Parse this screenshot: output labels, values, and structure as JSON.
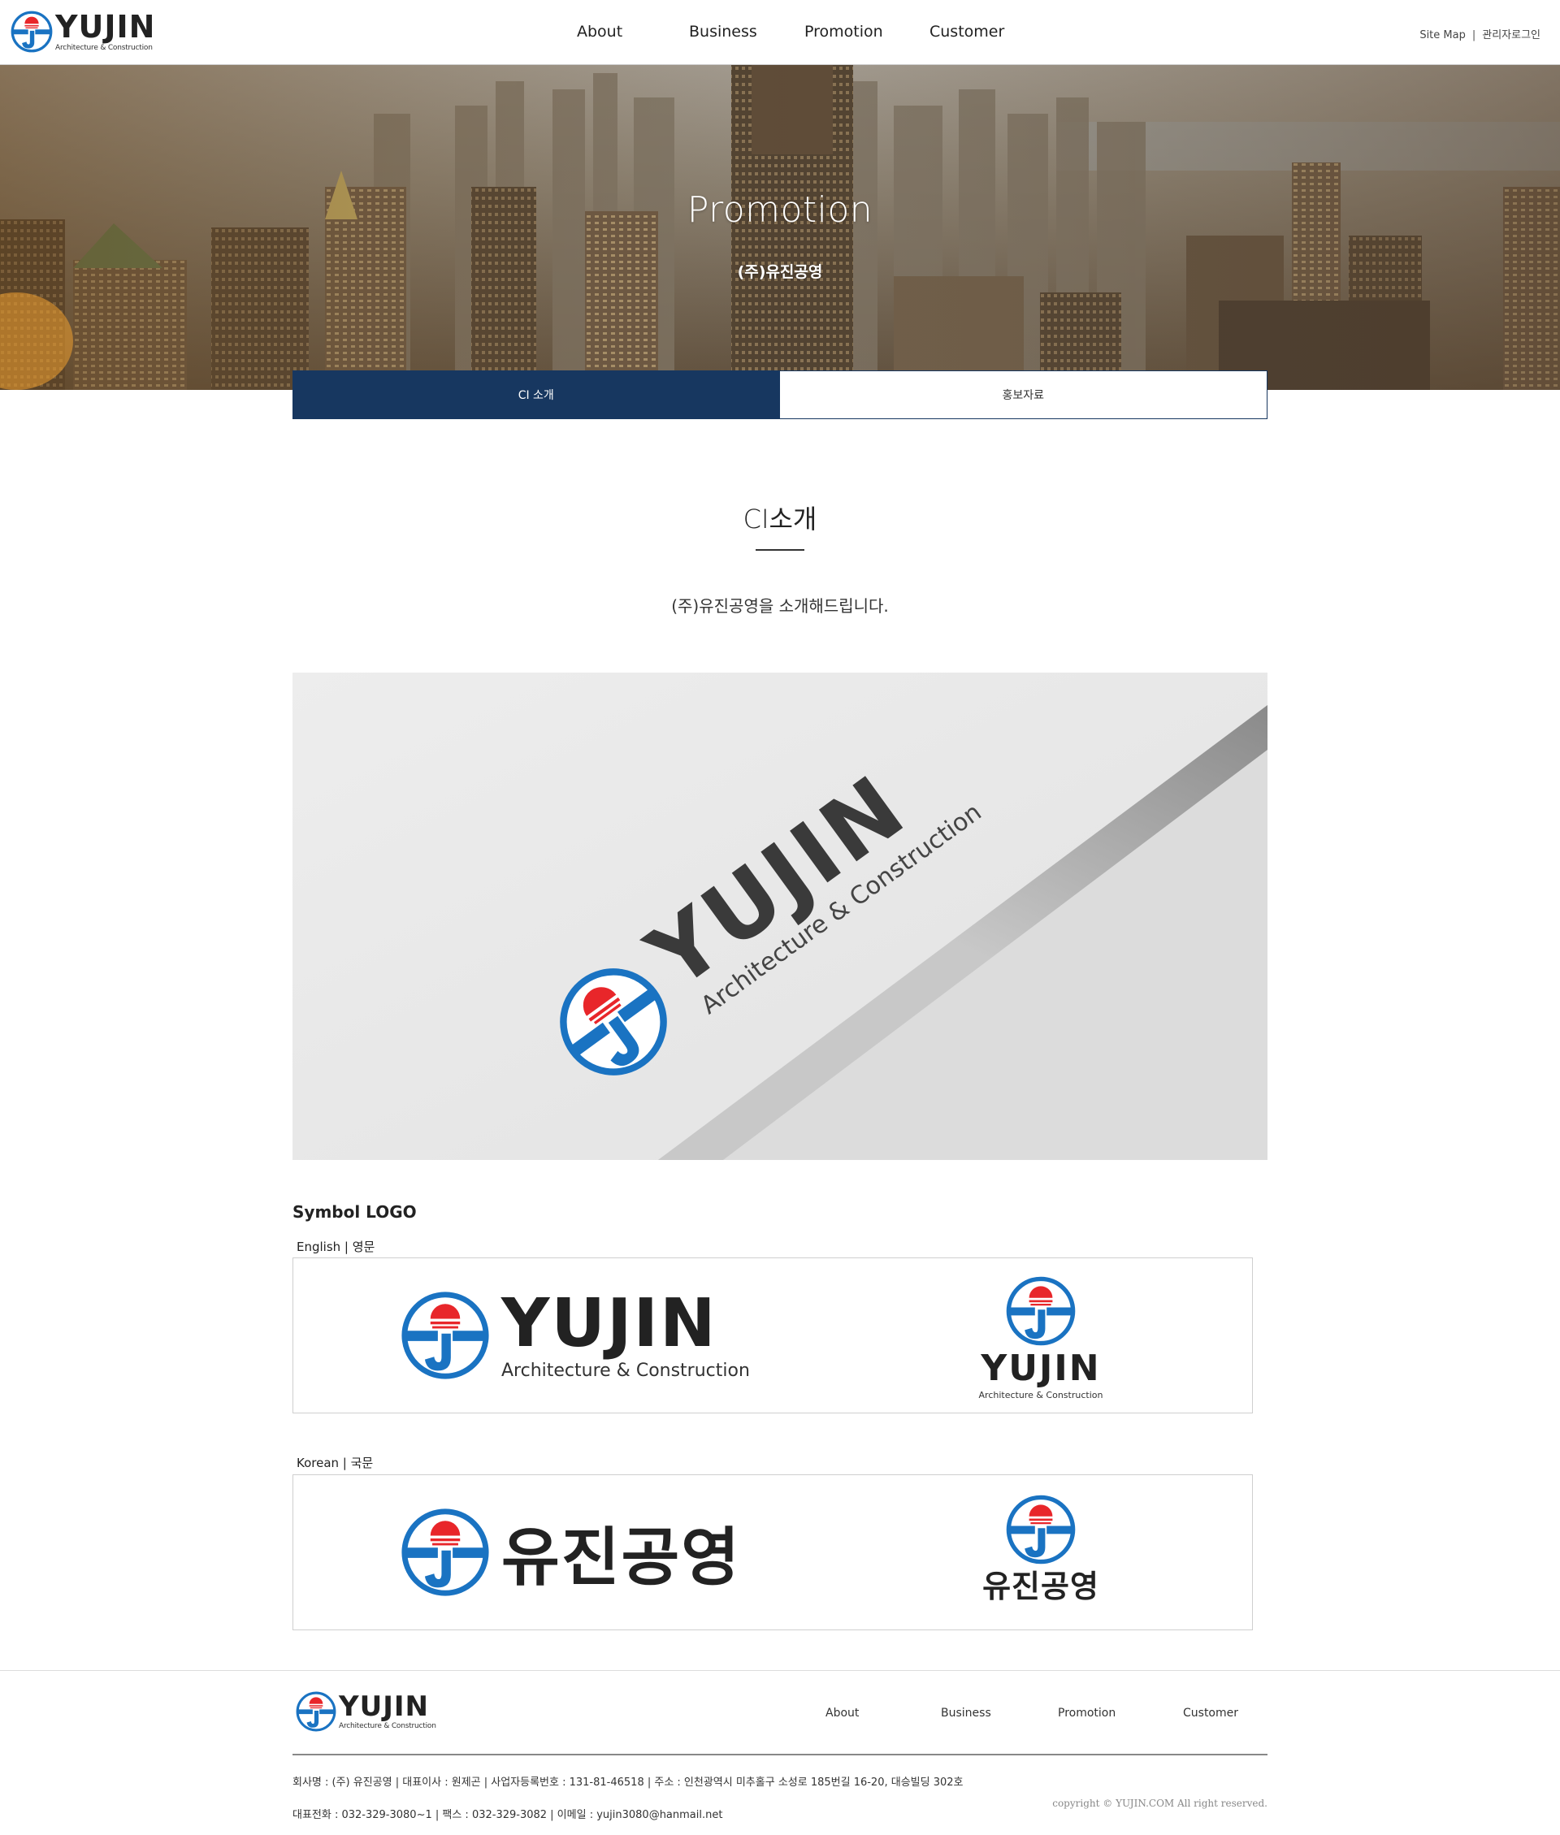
{
  "header": {
    "brand_name": "YUJIN",
    "brand_sub": "Architecture & Construction",
    "nav": [
      "About",
      "Business",
      "Promotion",
      "Customer"
    ],
    "util": {
      "sitemap": "Site Map",
      "separator": "|",
      "admin_login": "관리자로그인"
    }
  },
  "hero": {
    "title": "Promotion",
    "subtitle": "(주)유진공영"
  },
  "tabs": [
    {
      "label": "CI 소개",
      "active": true
    },
    {
      "label": "홍보자료",
      "active": false
    }
  ],
  "content": {
    "title": "CI소개",
    "description": "(주)유진공영을 소개해드립니다.",
    "mockup": {
      "brand_name": "YUJIN",
      "brand_sub": "Architecture & Construction"
    },
    "symbol_title": "Symbol LOGO",
    "english_label": "English | 영문",
    "korean_label": "Korean | 국문",
    "english_logo": {
      "name": "YUJIN",
      "sub": "Architecture & Construction"
    },
    "korean_logo": {
      "name": "유진공영"
    }
  },
  "footer": {
    "brand_name": "YUJIN",
    "brand_sub": "Architecture & Construction",
    "nav": [
      "About",
      "Business",
      "Promotion",
      "Customer"
    ],
    "info_line1": "회사명 : (주) 유진공영 | 대표이사 : 원제곤 | 사업자등록번호 : 131-81-46518 | 주소 : 인천광역시 미추홀구 소성로 185번길 16-20, 대승빌딩 302호",
    "info_line2": "대표전화 : 032-329-3080~1 | 팩스 : 032-329-3082 | 이메일 : yujin3080@hanmail.net",
    "copyright": "copyright © YUJIN.COM All right reserved."
  },
  "colors": {
    "brand_navy": "#173760",
    "logo_blue": "#1a73c2",
    "logo_red": "#e8262a",
    "text_dark": "#222222"
  },
  "icons": [
    "yujin-logo-mark-icon"
  ]
}
